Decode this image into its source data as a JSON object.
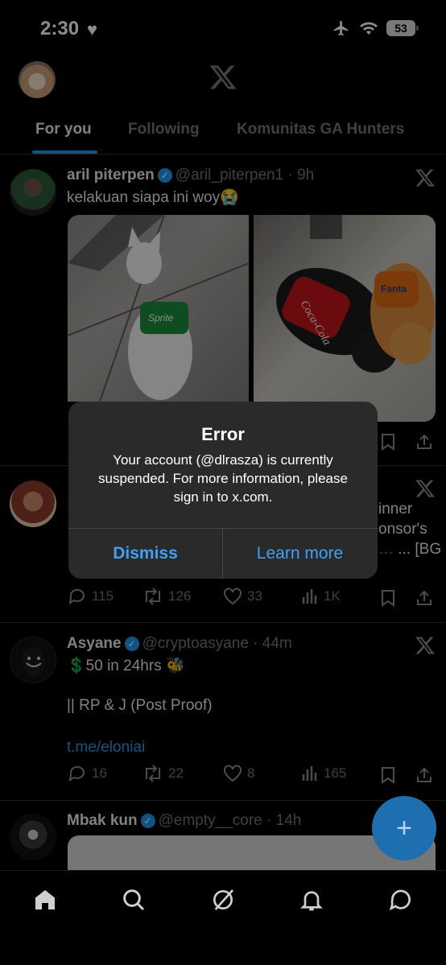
{
  "status": {
    "time": "2:30",
    "battery": "53"
  },
  "tabs": [
    {
      "label": "For you"
    },
    {
      "label": "Following"
    },
    {
      "label": "Komunitas GA Hunters"
    }
  ],
  "posts": [
    {
      "name": "aril piterpen",
      "handle": "@aril_piterpen1",
      "time": "9h",
      "text": "kelakuan siapa ini woy😭"
    },
    {
      "partial_right": [
        "inner",
        "onsor's",
        "... [BG"
      ],
      "stats": {
        "replies": "115",
        "reposts": "126",
        "likes": "33",
        "views": "1K"
      }
    },
    {
      "name": "Asyane",
      "handle": "@cryptoasyane",
      "time": "44m",
      "line1": "💲50 in 24hrs 🐝",
      "line2": "|| RP & J (Post Proof)",
      "link": "t.me/eloniai",
      "stats": {
        "replies": "16",
        "reposts": "22",
        "likes": "8",
        "views": "165"
      }
    },
    {
      "name": "Mbak kun",
      "handle": "@empty__core",
      "time": "14h"
    }
  ],
  "dialog": {
    "title": "Error",
    "message": "Your account (@dlrasza) is currently suspended. For more information, please sign in to x.com.",
    "dismiss": "Dismiss",
    "learn_more": "Learn more"
  },
  "fab": {
    "label": "+"
  },
  "colors": {
    "accent": "#1d9bf0",
    "background": "#000000",
    "dialog": "#2a2a2b"
  }
}
